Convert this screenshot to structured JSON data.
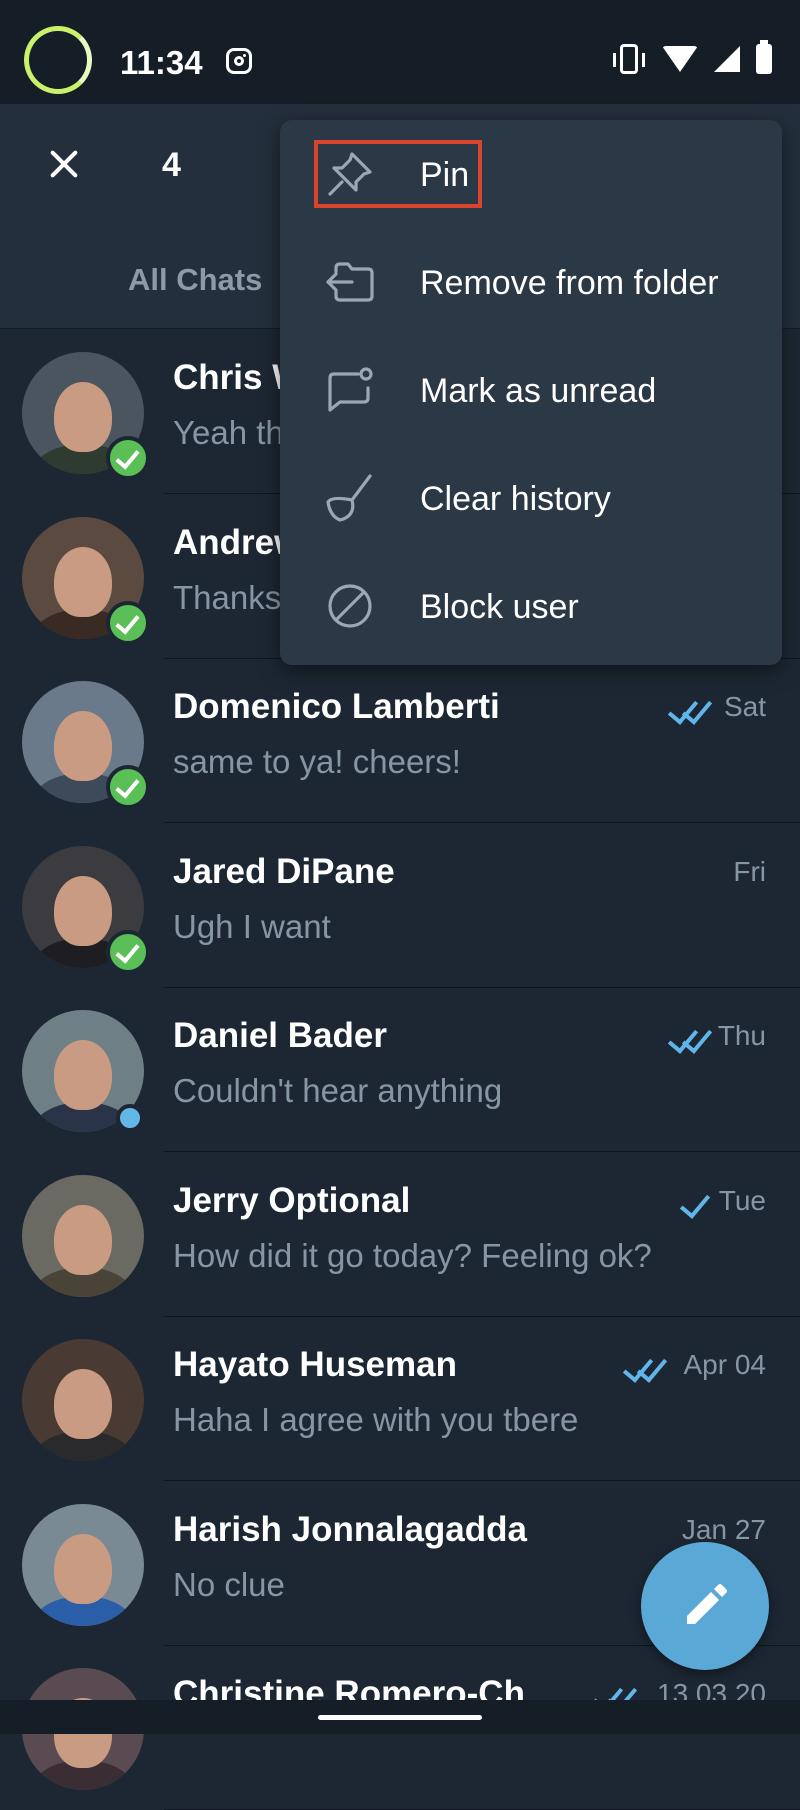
{
  "status_bar": {
    "time": "11:34"
  },
  "header": {
    "selected_count": "4"
  },
  "tabs": {
    "all_chats": "All Chats"
  },
  "context_menu": {
    "items": [
      {
        "label": "Pin",
        "icon": "pin-icon"
      },
      {
        "label": "Remove from folder",
        "icon": "folder-remove-icon"
      },
      {
        "label": "Mark as unread",
        "icon": "mark-unread-icon"
      },
      {
        "label": "Clear history",
        "icon": "broom-icon"
      },
      {
        "label": "Block user",
        "icon": "block-icon"
      }
    ]
  },
  "chats": [
    {
      "name": "Chris W",
      "message": "Yeah th",
      "time": "",
      "ticks": 0,
      "badge": "selected"
    },
    {
      "name": "Andrew",
      "message": "Thanks",
      "time": "",
      "ticks": 0,
      "badge": "selected"
    },
    {
      "name": "Domenico Lamberti",
      "message": "same to ya! cheers!",
      "time": "Sat",
      "ticks": 2,
      "badge": "selected"
    },
    {
      "name": "Jared DiPane",
      "message": "Ugh I want",
      "time": "Fri",
      "ticks": 0,
      "badge": "selected"
    },
    {
      "name": "Daniel Bader",
      "message": "Couldn't hear anything",
      "time": "Thu",
      "ticks": 2,
      "badge": "online"
    },
    {
      "name": "Jerry Optional",
      "message": "How did it go today? Feeling ok?",
      "time": "Tue",
      "ticks": 1,
      "badge": ""
    },
    {
      "name": "Hayato Huseman",
      "message": "Haha I agree with you tbere",
      "time": "Apr 04",
      "ticks": 2,
      "badge": ""
    },
    {
      "name": "Harish Jonnalagadda",
      "message": "No clue",
      "time": "Jan 27",
      "ticks": 0,
      "badge": ""
    },
    {
      "name": "Christine Romero-Ch",
      "message": "",
      "time": "13.03.20",
      "ticks": 2,
      "badge": ""
    }
  ],
  "colors": {
    "accent": "#5aa8d6",
    "selected_badge": "#5bbf57",
    "highlight": "#d9442f"
  }
}
